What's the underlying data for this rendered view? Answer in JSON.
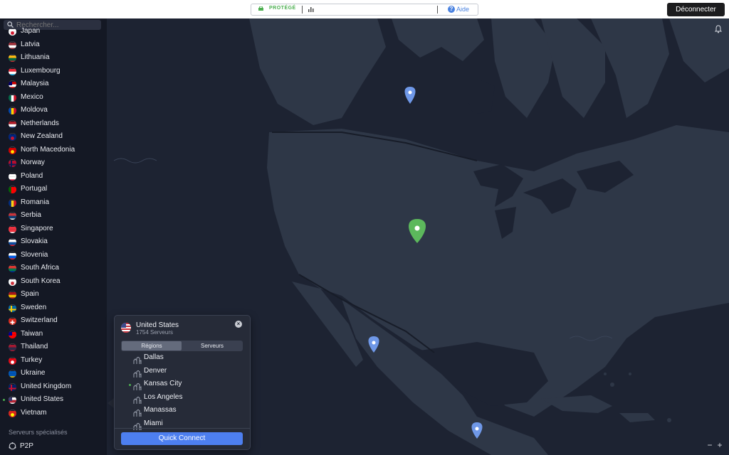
{
  "topbar": {
    "status": "PROTÉGÉ",
    "help_label": "Aide",
    "disconnect_label": "Déconnecter"
  },
  "search": {
    "placeholder": "Rechercher..."
  },
  "countries": [
    {
      "name": "Japan"
    },
    {
      "name": "Latvia"
    },
    {
      "name": "Lithuania"
    },
    {
      "name": "Luxembourg"
    },
    {
      "name": "Malaysia"
    },
    {
      "name": "Mexico"
    },
    {
      "name": "Moldova"
    },
    {
      "name": "Netherlands"
    },
    {
      "name": "New Zealand"
    },
    {
      "name": "North Macedonia"
    },
    {
      "name": "Norway"
    },
    {
      "name": "Poland"
    },
    {
      "name": "Portugal"
    },
    {
      "name": "Romania"
    },
    {
      "name": "Serbia"
    },
    {
      "name": "Singapore"
    },
    {
      "name": "Slovakia"
    },
    {
      "name": "Slovenia"
    },
    {
      "name": "South Africa"
    },
    {
      "name": "South Korea"
    },
    {
      "name": "Spain"
    },
    {
      "name": "Sweden"
    },
    {
      "name": "Switzerland"
    },
    {
      "name": "Taiwan"
    },
    {
      "name": "Thailand"
    },
    {
      "name": "Turkey"
    },
    {
      "name": "Ukraine"
    },
    {
      "name": "United Kingdom"
    },
    {
      "name": "United States"
    },
    {
      "name": "Vietnam"
    }
  ],
  "specialty": {
    "section_label": "Serveurs spécialisés",
    "p2p_label": "P2P"
  },
  "popup": {
    "country": "United States",
    "servers": "1754 Serveurs",
    "tabs": [
      "Régions",
      "Serveurs"
    ],
    "regions": [
      "Dallas",
      "Denver",
      "Kansas City",
      "Los Angeles",
      "Manassas",
      "Miami"
    ],
    "connected_region": "Kansas City",
    "quick_connect_label": "Quick Connect"
  },
  "colors": {
    "protected": "#4caf50",
    "accent": "#4d7ff0",
    "map_land": "#2e3747",
    "map_water": "#1d2332",
    "pin_connected": "#5cb85c",
    "pin_server": "#6f98e8"
  }
}
